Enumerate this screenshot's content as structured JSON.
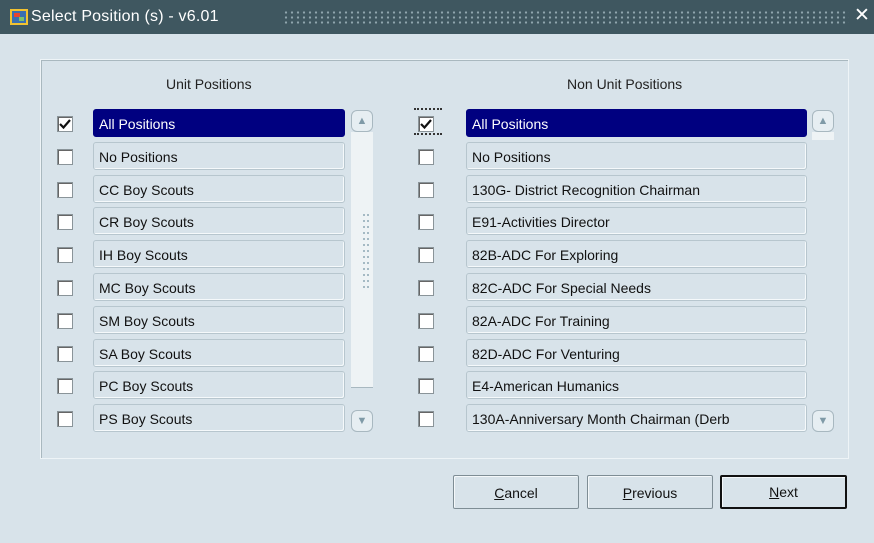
{
  "window": {
    "title": "Select Position (s) - v6.01",
    "close_glyph": "✕",
    "app_icon": "oracle-forms-icon"
  },
  "unit_positions": {
    "header": "Unit Positions",
    "items": [
      {
        "label": "All Positions",
        "checked": true,
        "selected": true
      },
      {
        "label": "No Positions",
        "checked": false,
        "selected": false
      },
      {
        "label": "CC Boy Scouts",
        "checked": false,
        "selected": false
      },
      {
        "label": "CR Boy Scouts",
        "checked": false,
        "selected": false
      },
      {
        "label": "IH Boy Scouts",
        "checked": false,
        "selected": false
      },
      {
        "label": "MC Boy Scouts",
        "checked": false,
        "selected": false
      },
      {
        "label": "SM Boy Scouts",
        "checked": false,
        "selected": false
      },
      {
        "label": "SA Boy Scouts",
        "checked": false,
        "selected": false
      },
      {
        "label": "PC Boy Scouts",
        "checked": false,
        "selected": false
      },
      {
        "label": "PS Boy Scouts",
        "checked": false,
        "selected": false
      }
    ]
  },
  "non_unit_positions": {
    "header": "Non Unit Positions",
    "items": [
      {
        "label": "All Positions",
        "checked": true,
        "selected": true
      },
      {
        "label": "No Positions",
        "checked": false,
        "selected": false
      },
      {
        "label": "130G- District Recognition Chairman",
        "checked": false,
        "selected": false
      },
      {
        "label": "E91-Activities Director",
        "checked": false,
        "selected": false
      },
      {
        "label": "82B-ADC For Exploring",
        "checked": false,
        "selected": false
      },
      {
        "label": "82C-ADC For Special Needs",
        "checked": false,
        "selected": false
      },
      {
        "label": "82A-ADC For Training",
        "checked": false,
        "selected": false
      },
      {
        "label": "82D-ADC For Venturing",
        "checked": false,
        "selected": false
      },
      {
        "label": "E4-American Humanics",
        "checked": false,
        "selected": false
      },
      {
        "label": "130A-Anniversary Month Chairman  (Derb",
        "checked": false,
        "selected": false
      }
    ]
  },
  "buttons": {
    "cancel": {
      "mnemonic": "C",
      "rest": "ancel"
    },
    "previous": {
      "mnemonic": "P",
      "rest": "revious"
    },
    "next": {
      "mnemonic": "N",
      "rest": "ext"
    }
  },
  "colors": {
    "titlebar": "#3f5760",
    "background": "#d8e3ea",
    "selection": "#000080"
  }
}
